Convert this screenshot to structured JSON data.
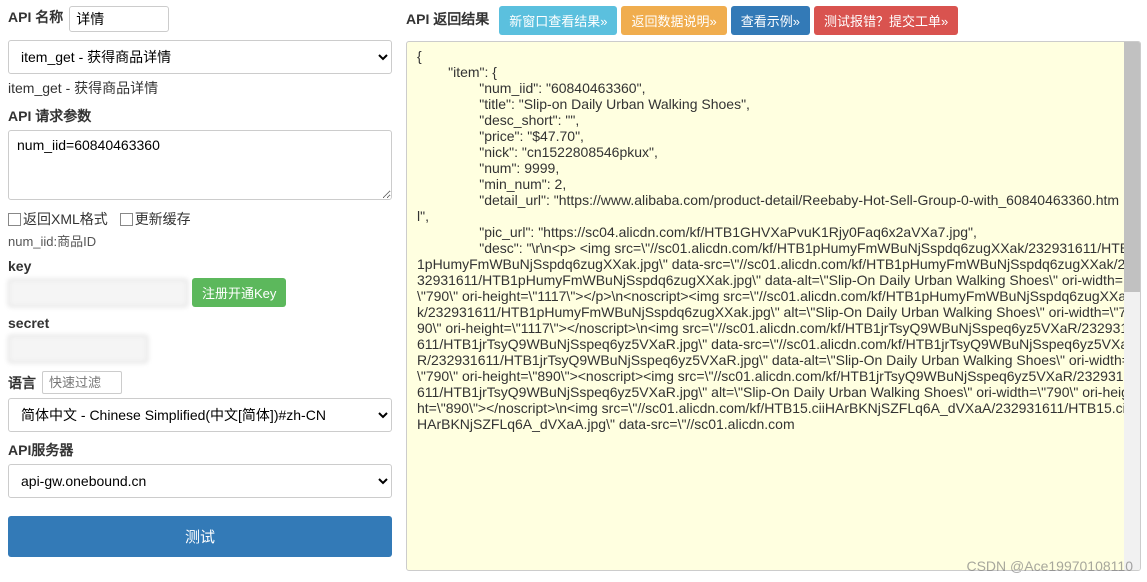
{
  "left": {
    "api_name_label": "API 名称",
    "api_name_value": "详情",
    "select_value": "item_get - 获得商品详情",
    "select_echo": "item_get - 获得商品详情",
    "req_params_label": "API 请求参数",
    "req_params_value": "num_iid=60840463360",
    "cb_xml": "返回XML格式",
    "cb_refresh": "更新缓存",
    "param_help": "num_iid:商品ID",
    "key_label": "key",
    "register_key_btn": "注册开通Key",
    "secret_label": "secret",
    "lang_label": "语言",
    "lang_filter_placeholder": "快速过滤",
    "lang_value": "简体中文 - Chinese Simplified(中文[简体])#zh-CN",
    "server_label": "API服务器",
    "server_value": "api-gw.onebound.cn",
    "test_btn": "测试"
  },
  "right": {
    "result_label": "API 返回结果",
    "btn_new_window": "新窗口查看结果»",
    "btn_data_desc": "返回数据说明»",
    "btn_example": "查看示例»",
    "btn_report": "测试报错？提交工单»",
    "json_text": "{\n        \"item\": {\n                \"num_iid\": \"60840463360\",\n                \"title\": \"Slip-on Daily Urban Walking Shoes\",\n                \"desc_short\": \"\",\n                \"price\": \"$47.70\",\n                \"nick\": \"cn1522808546pkux\",\n                \"num\": 9999,\n                \"min_num\": 2,\n                \"detail_url\": \"https://www.alibaba.com/product-detail/Reebaby-Hot-Sell-Group-0-with_60840463360.html\",\n                \"pic_url\": \"https://sc04.alicdn.com/kf/HTB1GHVXaPvuK1Rjy0Faq6x2aVXa7.jpg\",\n                \"desc\": \"\\r\\n<p> <img src=\\\"//sc01.alicdn.com/kf/HTB1pHumyFmWBuNjSspdq6zugXXak/232931611/HTB1pHumyFmWBuNjSspdq6zugXXak.jpg\\\" data-src=\\\"//sc01.alicdn.com/kf/HTB1pHumyFmWBuNjSspdq6zugXXak/232931611/HTB1pHumyFmWBuNjSspdq6zugXXak.jpg\\\" data-alt=\\\"Slip-On Daily Urban Walking Shoes\\\" ori-width=\\\"790\\\" ori-height=\\\"1117\\\"></p>\\n<noscript><img src=\\\"//sc01.alicdn.com/kf/HTB1pHumyFmWBuNjSspdq6zugXXak/232931611/HTB1pHumyFmWBuNjSspdq6zugXXak.jpg\\\" alt=\\\"Slip-On Daily Urban Walking Shoes\\\" ori-width=\\\"790\\\" ori-height=\\\"1117\\\"></noscript>\\n<img src=\\\"//sc01.alicdn.com/kf/HTB1jrTsyQ9WBuNjSspeq6yz5VXaR/232931611/HTB1jrTsyQ9WBuNjSspeq6yz5VXaR.jpg\\\" data-src=\\\"//sc01.alicdn.com/kf/HTB1jrTsyQ9WBuNjSspeq6yz5VXaR/232931611/HTB1jrTsyQ9WBuNjSspeq6yz5VXaR.jpg\\\" data-alt=\\\"Slip-On Daily Urban Walking Shoes\\\" ori-width=\\\"790\\\" ori-height=\\\"890\\\"><noscript><img src=\\\"//sc01.alicdn.com/kf/HTB1jrTsyQ9WBuNjSspeq6yz5VXaR/232931611/HTB1jrTsyQ9WBuNjSspeq6yz5VXaR.jpg\\\" alt=\\\"Slip-On Daily Urban Walking Shoes\\\" ori-width=\\\"790\\\" ori-height=\\\"890\\\"></noscript>\\n<img src=\\\"//sc01.alicdn.com/kf/HTB15.ciiHArBKNjSZFLq6A_dVXaA/232931611/HTB15.ciiHArBKNjSZFLq6A_dVXaA.jpg\\\" data-src=\\\"//sc01.alicdn.com"
  },
  "watermark": "CSDN @Ace19970108110"
}
